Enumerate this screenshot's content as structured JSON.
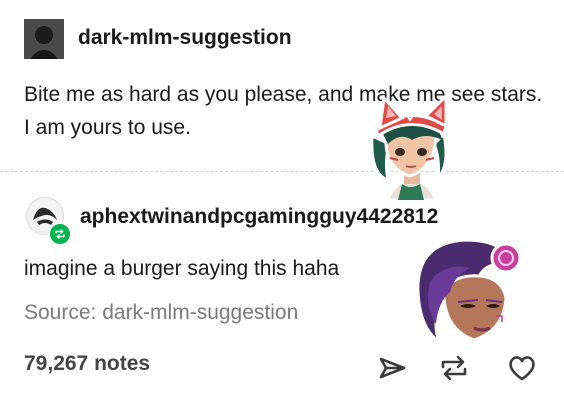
{
  "posts": [
    {
      "username": "dark-mlm-suggestion",
      "text": "Bite me as hard as you please, and make me see stars. I am yours to use.",
      "avatar_icon": "dark-silhouette-avatar"
    },
    {
      "username": "aphextwinandpcgamingguy4422812",
      "text": "imagine a burger saying this haha",
      "avatar_icon": "aphex-twin-logo",
      "badge_icon": "reblog-badge-icon"
    }
  ],
  "source": {
    "label": "Source: dark-mlm-suggestion"
  },
  "footer": {
    "notes": "79,267 notes"
  },
  "actions": [
    {
      "name": "share",
      "icon": "send-arrow-icon"
    },
    {
      "name": "reblog",
      "icon": "reblog-icon"
    },
    {
      "name": "like",
      "icon": "heart-icon"
    }
  ],
  "stickers": [
    {
      "name": "kiriko-sticker",
      "description_icon": "overwatch-character-sticker"
    },
    {
      "name": "sombra-sticker",
      "description_icon": "overwatch-character-sticker"
    }
  ],
  "colors": {
    "text": "#1a1a1a",
    "muted": "#7a7a7a",
    "notes": "#444444",
    "reblog_green": "#00b34d"
  }
}
